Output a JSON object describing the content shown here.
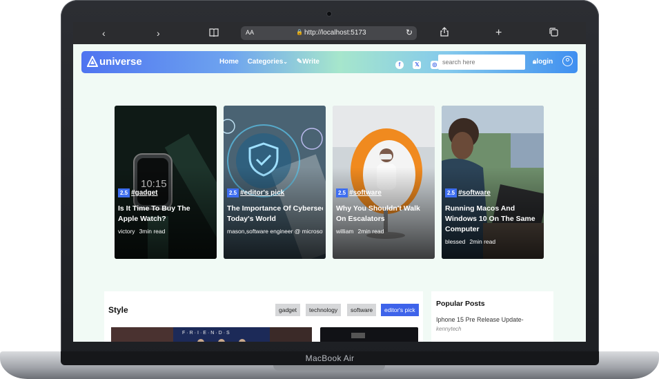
{
  "device": {
    "label": "MacBook Air"
  },
  "browser": {
    "text_size_label": "AA",
    "url": "http://localhost:5173",
    "icons": [
      "back-icon",
      "forward-icon",
      "book-icon",
      "lock-icon",
      "reload-icon",
      "share-icon",
      "plus-icon",
      "tabs-icon"
    ]
  },
  "nav": {
    "logo": "universe",
    "links": {
      "home": "Home",
      "categories": "Categories",
      "write": "Write"
    },
    "social_icons": [
      "facebook-icon",
      "x-icon",
      "instagram-icon"
    ],
    "search_placeholder": "search here",
    "login": "login",
    "accent": "#3e6ef0"
  },
  "cards": [
    {
      "score": "2.5",
      "tag": "#gadget",
      "title_lines": [
        "Is It Time To Buy The",
        "Apple Watch?"
      ],
      "author": "victory",
      "read": "3min read"
    },
    {
      "score": "2.5",
      "tag": "#editor's pick",
      "title_lines": [
        "The Importance Of Cybersecurity In",
        "Today's World"
      ],
      "author": "mason,software engineer @ microsoft",
      "read": ""
    },
    {
      "score": "2.5",
      "tag": "#software",
      "title_lines": [
        "Why You Shouldn't Walk",
        "On Escalators"
      ],
      "author": "william",
      "read": "2min read"
    },
    {
      "score": "2.5",
      "tag": "#software",
      "title_lines": [
        "Running Macos And",
        "Windows 10 On The Same",
        "Computer"
      ],
      "author": "blessed",
      "read": "2min read"
    }
  ],
  "style_section": {
    "title": "Style",
    "categories": [
      "gadget",
      "technology",
      "software",
      "editor's pick"
    ],
    "active_category": "editor's pick"
  },
  "popular": {
    "title": "Popular Posts",
    "items": [
      {
        "title": "Iphone 15 Pre Release Update-",
        "author": "kennytech"
      }
    ]
  }
}
